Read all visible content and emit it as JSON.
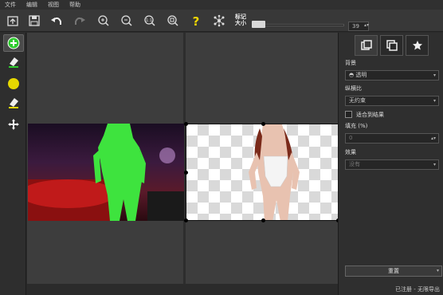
{
  "menu": [
    "文件",
    "编辑",
    "视图",
    "帮助"
  ],
  "toolbar": {
    "mark_size_label_1": "标记",
    "mark_size_label_2": "大小",
    "mark_size_value": "39",
    "mark_size_level": 0.15,
    "icons": [
      "open-icon",
      "save-icon",
      "undo-icon",
      "redo-icon",
      "zoom-in-icon",
      "zoom-out-icon",
      "zoom-actual-icon",
      "zoom-fit-icon",
      "help-icon",
      "network-icon"
    ]
  },
  "left_tools": [
    "add-foreground-icon",
    "eraser-icon",
    "yellow-dot-icon",
    "eraser-icon",
    "move-icon"
  ],
  "panel": {
    "background_label": "背景",
    "background_value": "透明",
    "crop_label": "纵横比",
    "crop_value": "无约束",
    "fit_label": "适合到结果",
    "padding_label": "填充 (%)",
    "padding_value": "0",
    "effect_label": "效果",
    "effect_value": "没有",
    "reset_label": "重置"
  },
  "status_text": "已注册 - 无限导出",
  "colors": {
    "accent_green": "#2ecc2e",
    "marker_yellow": "#e6d800",
    "background": "#2b2b2b"
  }
}
